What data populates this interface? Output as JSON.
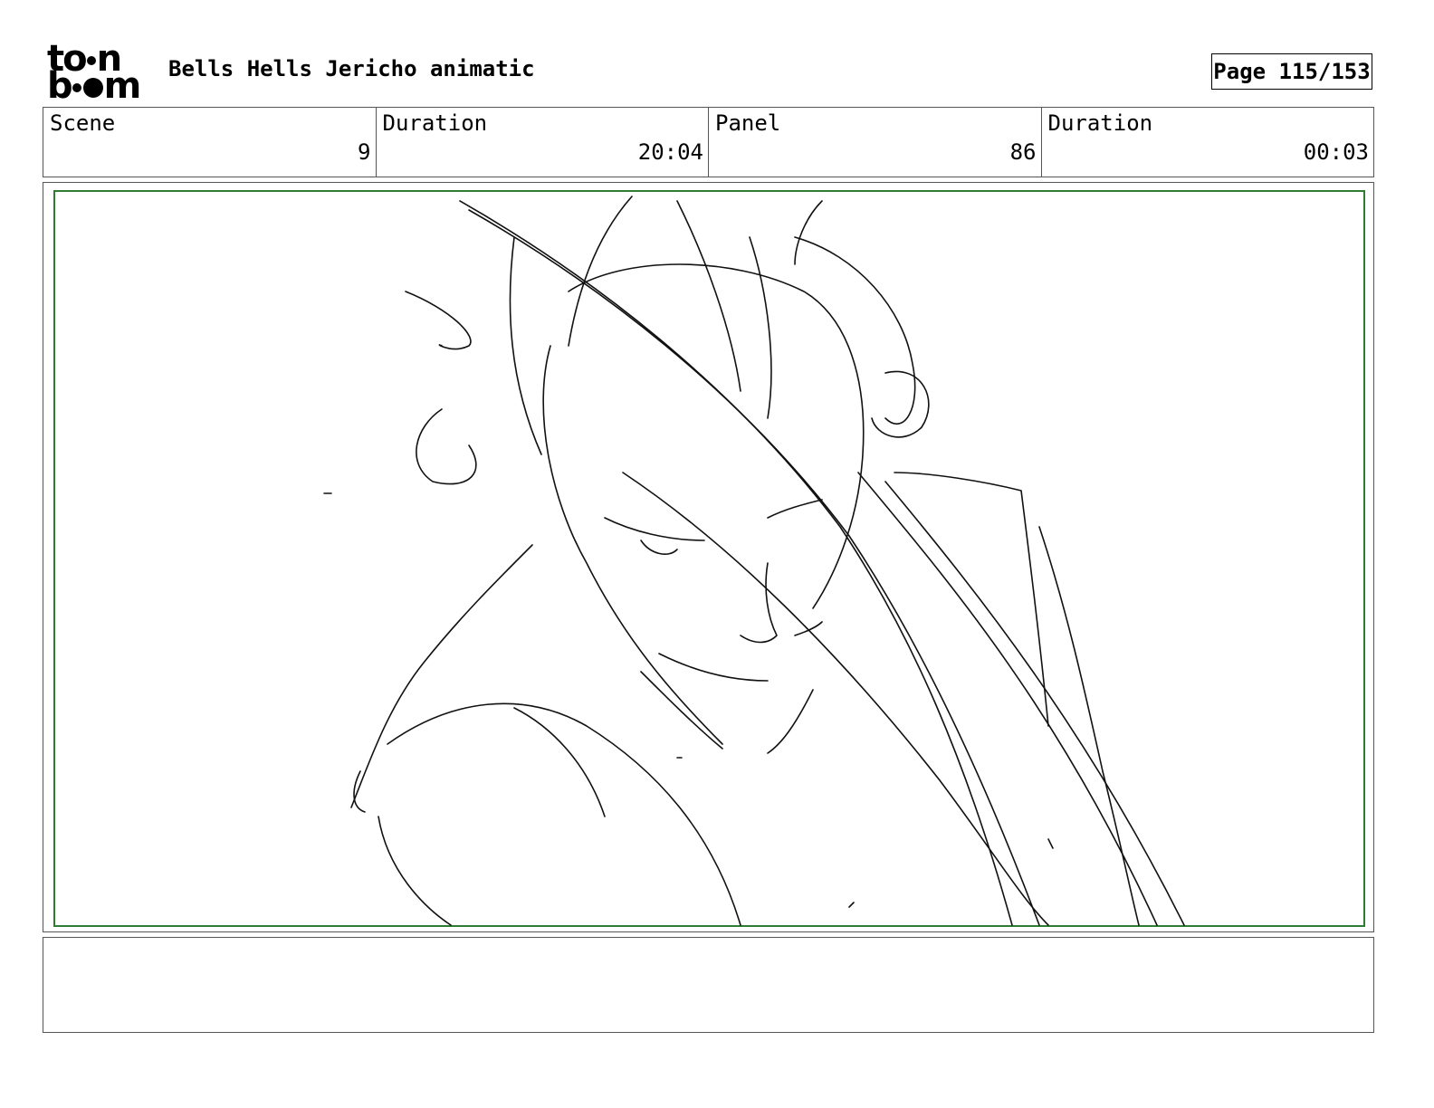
{
  "header": {
    "logo_top": "to",
    "logo_top_end": "n",
    "logo_bottom_start": "b",
    "logo_bottom_end": "m",
    "project_title": "Bells Hells Jericho animatic",
    "page_label": "Page 115/153"
  },
  "info": {
    "scene_label": "Scene",
    "scene_value": "9",
    "scene_duration_label": "Duration",
    "scene_duration_value": "20:04",
    "panel_label": "Panel",
    "panel_value": "86",
    "panel_duration_label": "Duration",
    "panel_duration_value": "00:03"
  },
  "panel": {
    "safe_area_color": "#2e7d32",
    "sketch_icon": "character-sketch"
  },
  "notes": {
    "text": ""
  }
}
